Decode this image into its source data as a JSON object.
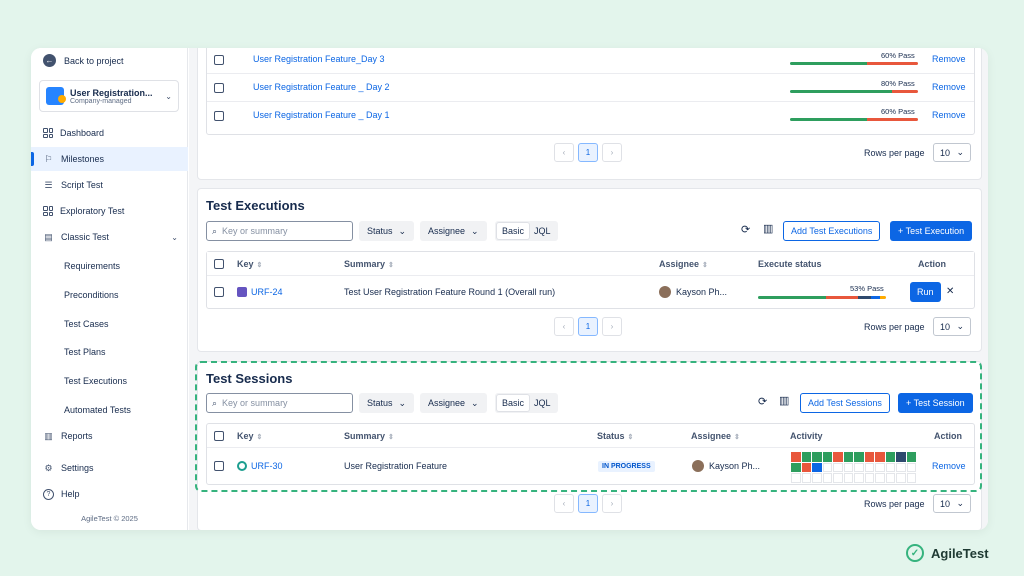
{
  "sidebar": {
    "back": "Back to project",
    "project_name": "User Registration...",
    "project_type": "Company-managed",
    "items": [
      {
        "label": "Dashboard",
        "icon": "dashboard-icon"
      },
      {
        "label": "Milestones",
        "icon": "flag-icon"
      },
      {
        "label": "Script Test",
        "icon": "list-icon"
      },
      {
        "label": "Exploratory Test",
        "icon": "grid-icon"
      },
      {
        "label": "Classic Test",
        "icon": "table-icon"
      }
    ],
    "sub_items": [
      "Requirements",
      "Preconditions",
      "Test Cases",
      "Test Plans",
      "Test Executions",
      "Automated Tests"
    ],
    "bottom_items": [
      {
        "label": "Reports",
        "icon": "chart-icon"
      },
      {
        "label": "Settings",
        "icon": "gear-icon"
      },
      {
        "label": "Help",
        "icon": "help-icon"
      }
    ],
    "copyright": "AgileTest © 2025"
  },
  "milestones_table": {
    "rows": [
      {
        "name": "User Registration Feature_Day 3",
        "pass": "60% Pass",
        "action": "Remove"
      },
      {
        "name": "User Registration Feature _ Day 2",
        "pass": "80% Pass",
        "action": "Remove"
      },
      {
        "name": "User Registration Feature _ Day 1",
        "pass": "60% Pass",
        "action": "Remove"
      }
    ],
    "page": "1",
    "rows_per_page_label": "Rows per page",
    "rows_per_page": "10"
  },
  "executions": {
    "title": "Test Executions",
    "search_placeholder": "Key or summary",
    "status_filter": "Status",
    "assignee_filter": "Assignee",
    "mode_basic": "Basic",
    "mode_jql": "JQL",
    "add_button": "Add Test Executions",
    "create_button": "+ Test Execution",
    "headers": {
      "key": "Key",
      "summary": "Summary",
      "assignee": "Assignee",
      "status": "Execute status",
      "action": "Action"
    },
    "rows": [
      {
        "key": "URF-24",
        "summary": "Test User Registration Feature Round 1 (Overall run)",
        "assignee": "Kayson Ph...",
        "pass": "53% Pass",
        "run": "Run"
      }
    ],
    "page": "1",
    "rows_per_page_label": "Rows per page",
    "rows_per_page": "10"
  },
  "sessions": {
    "title": "Test Sessions",
    "search_placeholder": "Key or summary",
    "status_filter": "Status",
    "assignee_filter": "Assignee",
    "mode_basic": "Basic",
    "mode_jql": "JQL",
    "add_button": "Add Test Sessions",
    "create_button": "+ Test Session",
    "headers": {
      "key": "Key",
      "summary": "Summary",
      "status": "Status",
      "assignee": "Assignee",
      "activity": "Activity",
      "action": "Action"
    },
    "rows": [
      {
        "key": "URF-30",
        "summary": "User Registration Feature",
        "status": "IN PROGRESS",
        "assignee": "Kayson Ph...",
        "action": "Remove"
      }
    ],
    "activity_colors": [
      "#e8573c",
      "#2e9e5e",
      "#2e9e5e",
      "#2e9e5e",
      "#e8573c",
      "#2e9e5e",
      "#2e9e5e",
      "#e8573c",
      "#e8573c",
      "#2e9e5e",
      "#2e4a6e",
      "#2e9e5e",
      "#2e9e5e",
      "#e8573c",
      "#0c66e4"
    ],
    "page": "1",
    "rows_per_page_label": "Rows per page",
    "rows_per_page": "10"
  },
  "colors": {
    "pass": "#2e9e5e",
    "fail": "#e8573c",
    "primary": "#0c66e4",
    "highlight": "#36b37e"
  },
  "brand": "AgileTest"
}
